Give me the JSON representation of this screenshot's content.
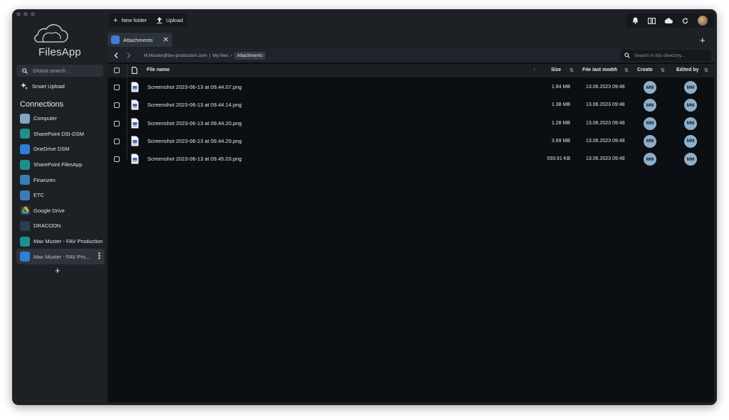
{
  "app": {
    "name": "FilesApp"
  },
  "sidebar": {
    "search_placeholder": "Global search...",
    "smart_upload": "Smart Upload",
    "connections_title": "Connections",
    "connections": [
      {
        "label": "Computer",
        "icon": "computer-icon",
        "color": "#7fa7c4"
      },
      {
        "label": "SharePoint DSI-DSM",
        "icon": "sharepoint-icon",
        "color": "#1f8f8c"
      },
      {
        "label": "OneDrive DSM",
        "icon": "onedrive-icon",
        "color": "#2f7ed8"
      },
      {
        "label": "SharePoint FilesApp",
        "icon": "sharepoint-icon",
        "color": "#1f8f8c"
      },
      {
        "label": "Finanzen",
        "icon": "folder-box-icon",
        "color": "#3b7bb8"
      },
      {
        "label": "ETC",
        "icon": "folder-box-icon",
        "color": "#3b7bb8"
      },
      {
        "label": "Google Drive",
        "icon": "google-drive-icon",
        "color": "#ffffff"
      },
      {
        "label": "DRACOON",
        "icon": "dracoon-icon",
        "color": "#2c3e50"
      },
      {
        "label": "Max Muster - FAV Production",
        "icon": "sharepoint-icon",
        "color": "#1f8f8c"
      },
      {
        "label": "Max Muster - FAV Pro...",
        "icon": "onedrive-icon",
        "color": "#2f7ed8",
        "active": true
      }
    ]
  },
  "toolbar": {
    "new_folder": "New folder",
    "upload": "Upload"
  },
  "tab": {
    "label": "Attachments"
  },
  "breadcrumb": {
    "account": "M.Muster@fav-production.com",
    "sep": "|",
    "folder": "My files",
    "arrow": "›",
    "current": "Attachments"
  },
  "dir_search_placeholder": "Search in this directory...",
  "table": {
    "headers": {
      "name": "File name",
      "size": "Size",
      "modified": "File last modifi",
      "created": "Create",
      "edited": "Edited by"
    },
    "rows": [
      {
        "name": "Screenshot 2023-06-13 at 09.44.07.png",
        "size": "1.64 MB",
        "modified": "13.06.2023 09:48",
        "created": "MM",
        "edited": "MM"
      },
      {
        "name": "Screenshot 2023-06-13 at 09.44.14.png",
        "size": "1.38 MB",
        "modified": "13.06.2023 09:48",
        "created": "MM",
        "edited": "MM"
      },
      {
        "name": "Screenshot 2023-06-13 at 09.44.20.png",
        "size": "1.28 MB",
        "modified": "13.06.2023 09:48",
        "created": "MM",
        "edited": "MM"
      },
      {
        "name": "Screenshot 2023-06-13 at 09.44.29.png",
        "size": "3.69 MB",
        "modified": "13.06.2023 09:48",
        "created": "MM",
        "edited": "MM"
      },
      {
        "name": "Screenshot 2023-06-13 at 09.45.03.png",
        "size": "593.91 KB",
        "modified": "13.06.2023 09:48",
        "created": "MM",
        "edited": "MM"
      }
    ]
  }
}
